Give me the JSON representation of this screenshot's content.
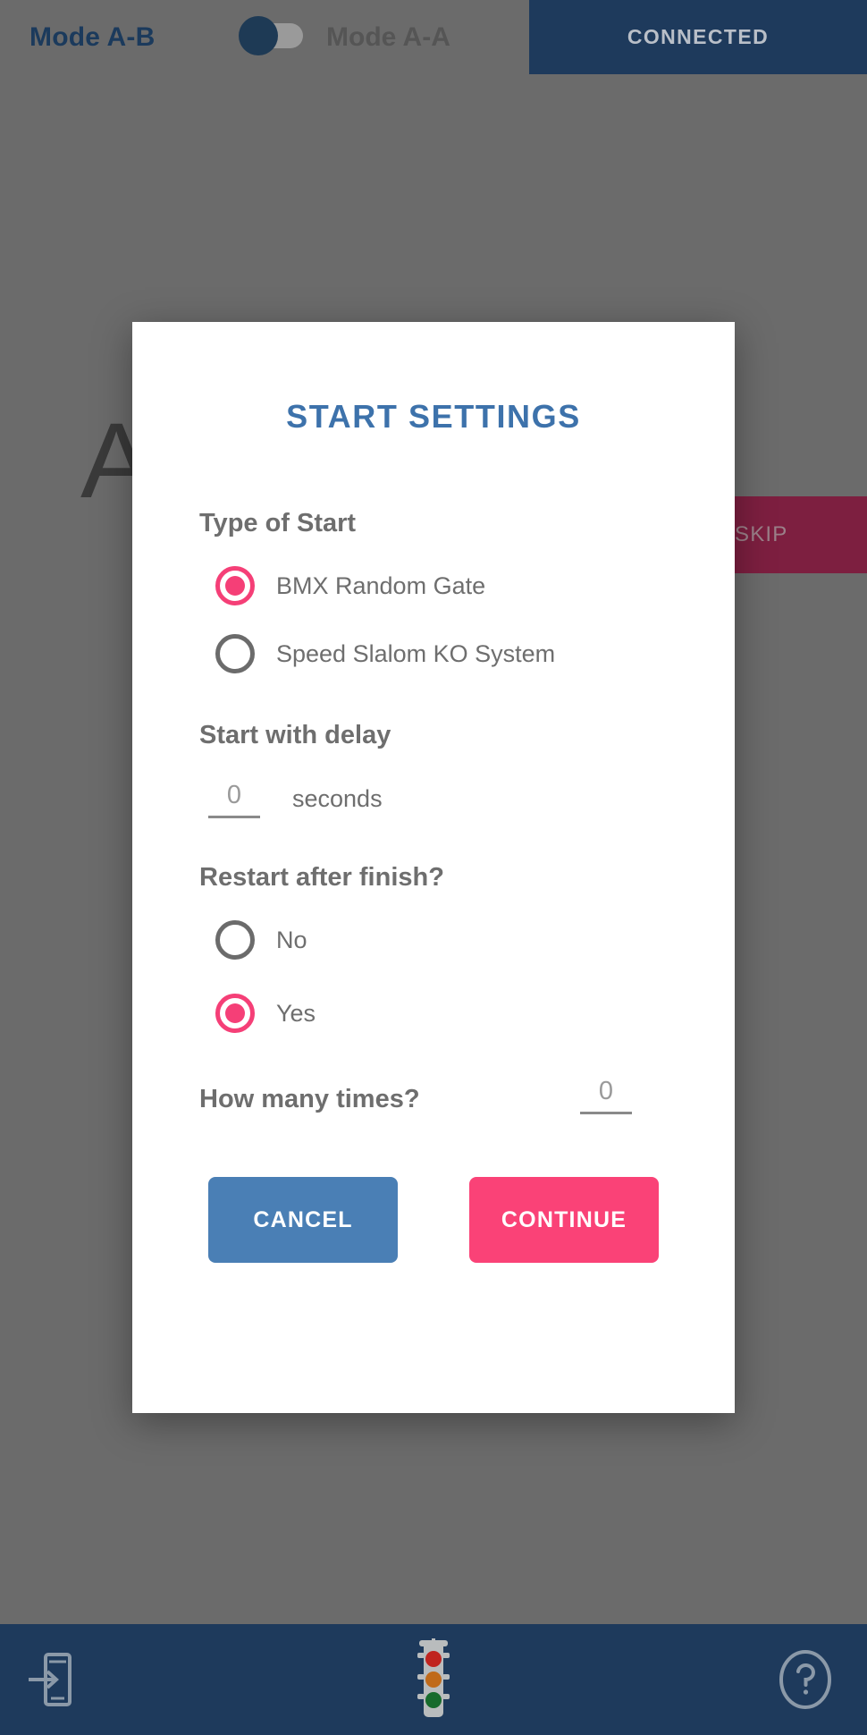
{
  "topbar": {
    "mode_left_label": "Mode A-B",
    "mode_right_label": "Mode A-A",
    "toggle_state": "left",
    "connection_status": "CONNECTED",
    "accent_navy": "#1e3a5c",
    "left_label_color": "#1b3a5c"
  },
  "background": {
    "partial_letter": "A",
    "skip_label": "SKIP",
    "skip_color": "#7d1f40"
  },
  "dialog": {
    "title": "START SETTINGS",
    "title_color": "#3d72ab",
    "sections": {
      "type_of_start": {
        "label": "Type of Start",
        "options": [
          {
            "label": "BMX Random Gate",
            "selected": true
          },
          {
            "label": "Speed Slalom KO System",
            "selected": false
          }
        ]
      },
      "start_with_delay": {
        "label": "Start with delay",
        "value": "0",
        "unit": "seconds"
      },
      "restart_after_finish": {
        "label": "Restart after finish?",
        "options": [
          {
            "label": "No",
            "selected": false
          },
          {
            "label": "Yes",
            "selected": true
          }
        ]
      },
      "how_many_times": {
        "label": "How many times?",
        "value": "0"
      }
    },
    "actions": {
      "cancel_label": "CANCEL",
      "continue_label": "CONTINUE",
      "cancel_color": "#4a7fb5",
      "continue_color": "#fa4277"
    },
    "radio_selected_color": "#f53f77",
    "radio_unselected_color": "#6b6b6b"
  },
  "bottom_nav": {
    "items": [
      {
        "icon": "phone-transfer-icon"
      },
      {
        "icon": "traffic-light-icon"
      },
      {
        "icon": "help-circle-icon"
      }
    ],
    "background": "#1e3a5c"
  }
}
